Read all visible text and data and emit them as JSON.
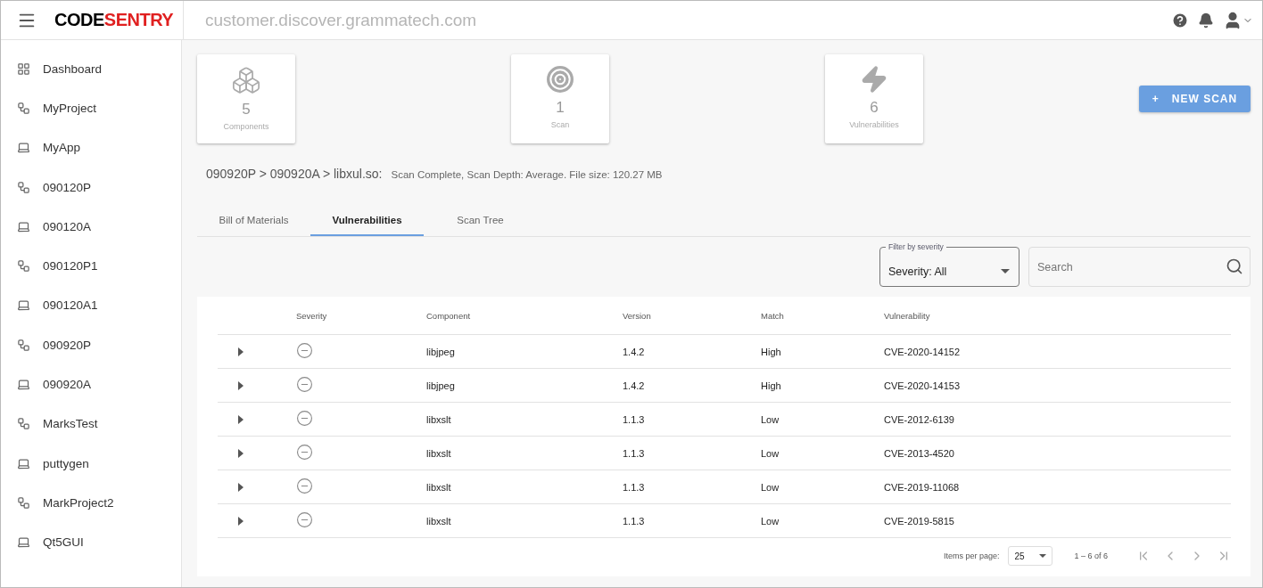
{
  "header": {
    "logo": {
      "first": "CODE",
      "second": "SENTRY"
    },
    "host": "customer.discover.grammatech.com"
  },
  "sidebar": {
    "items": [
      {
        "kind": "dashboard",
        "label": "Dashboard"
      },
      {
        "kind": "project",
        "label": "MyProject"
      },
      {
        "kind": "app",
        "label": "MyApp"
      },
      {
        "kind": "project",
        "label": "090120P"
      },
      {
        "kind": "app",
        "label": "090120A"
      },
      {
        "kind": "project",
        "label": "090120P1"
      },
      {
        "kind": "app",
        "label": "090120A1"
      },
      {
        "kind": "project",
        "label": "090920P"
      },
      {
        "kind": "app",
        "label": "090920A"
      },
      {
        "kind": "project",
        "label": "MarksTest"
      },
      {
        "kind": "app",
        "label": "puttygen"
      },
      {
        "kind": "project",
        "label": "MarkProject2"
      },
      {
        "kind": "app",
        "label": "Qt5GUI"
      }
    ]
  },
  "stats": [
    {
      "kind": "components",
      "value": "5",
      "label": "Components"
    },
    {
      "kind": "scan",
      "value": "1",
      "label": "Scan"
    },
    {
      "kind": "vulnerabilities",
      "value": "6",
      "label": "Vulnerabilities"
    }
  ],
  "new_scan_button": {
    "icon": "+",
    "label": "NEW SCAN"
  },
  "breadcrumb": {
    "path": "090920P > 090920A > libxul.so:",
    "status": "Scan Complete, Scan Depth: Average. File size: 120.27 MB"
  },
  "tabs": [
    {
      "label": "Bill of Materials",
      "selected": false
    },
    {
      "label": "Vulnerabilities",
      "selected": true
    },
    {
      "label": "Scan Tree",
      "selected": false
    }
  ],
  "filter": {
    "label": "Filter by severity",
    "value": "Severity: All"
  },
  "search": {
    "placeholder": "Search"
  },
  "table": {
    "columns": [
      "Severity",
      "Component",
      "Version",
      "Match",
      "Vulnerability"
    ],
    "rows": [
      {
        "expanded": false,
        "component": "libjpeg",
        "version": "1.4.2",
        "match": "High",
        "vulnerability": "CVE-2020-14152"
      },
      {
        "expanded": false,
        "component": "libjpeg",
        "version": "1.4.2",
        "match": "High",
        "vulnerability": "CVE-2020-14153"
      },
      {
        "expanded": false,
        "component": "libxslt",
        "version": "1.1.3",
        "match": "Low",
        "vulnerability": "CVE-2012-6139"
      },
      {
        "expanded": false,
        "component": "libxslt",
        "version": "1.1.3",
        "match": "Low",
        "vulnerability": "CVE-2013-4520"
      },
      {
        "expanded": false,
        "component": "libxslt",
        "version": "1.1.3",
        "match": "Low",
        "vulnerability": "CVE-2019-11068"
      },
      {
        "expanded": false,
        "component": "libxslt",
        "version": "1.1.3",
        "match": "Low",
        "vulnerability": "CVE-2019-5815"
      }
    ]
  },
  "pagination": {
    "items_label": "Items per page:",
    "page_size": "25",
    "range": "1 – 6 of 6"
  }
}
